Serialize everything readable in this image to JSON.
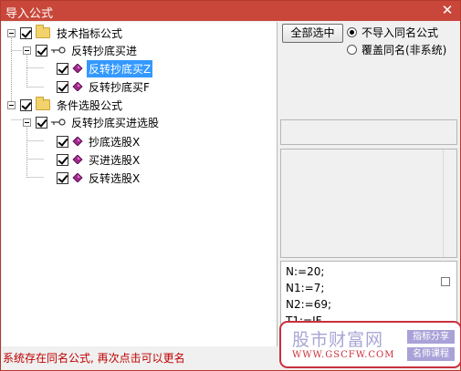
{
  "window": {
    "title": "导入公式",
    "close_glyph": "✕"
  },
  "tree": {
    "nodes": [
      {
        "label": "技术指标公式",
        "icon": "folder-icon",
        "checked": true,
        "expanded": true
      },
      {
        "label": "反转抄底买进",
        "icon": "key-icon",
        "checked": true,
        "expanded": true
      },
      {
        "label": "反转抄底买Z",
        "icon": "gem-icon",
        "checked": true,
        "selected": true
      },
      {
        "label": "反转抄底买F",
        "icon": "gem-icon",
        "checked": true
      },
      {
        "label": "条件选股公式",
        "icon": "folder-icon",
        "checked": true,
        "expanded": true
      },
      {
        "label": "反转抄底买进选股",
        "icon": "key-icon",
        "checked": true,
        "expanded": true
      },
      {
        "label": "抄底选股X",
        "icon": "gem-icon",
        "checked": true
      },
      {
        "label": "买进选股X",
        "icon": "gem-icon",
        "checked": true
      },
      {
        "label": "反转选股X",
        "icon": "gem-icon",
        "checked": true
      }
    ]
  },
  "options": {
    "select_all_label": "全部选中",
    "radio_no_import": "不导入同名公式",
    "radio_overwrite": "覆盖同名(非系统)",
    "selected_radio": "radio_no_import"
  },
  "code_preview": {
    "lines": [
      "N:=20;",
      "N1:=7;",
      "N2:=69;",
      "T1:=IF"
    ]
  },
  "status": {
    "message": "系统存在同名公式, 再次点击可以更名"
  },
  "watermark": {
    "brand": "股市财富网",
    "url": "WWW.GSCFW.COM",
    "tag1": "指标分享",
    "tag2": "名师课程"
  },
  "colors": {
    "title_bar": "#c9473a",
    "selection": "#3399ff",
    "status_text": "#c00000"
  }
}
